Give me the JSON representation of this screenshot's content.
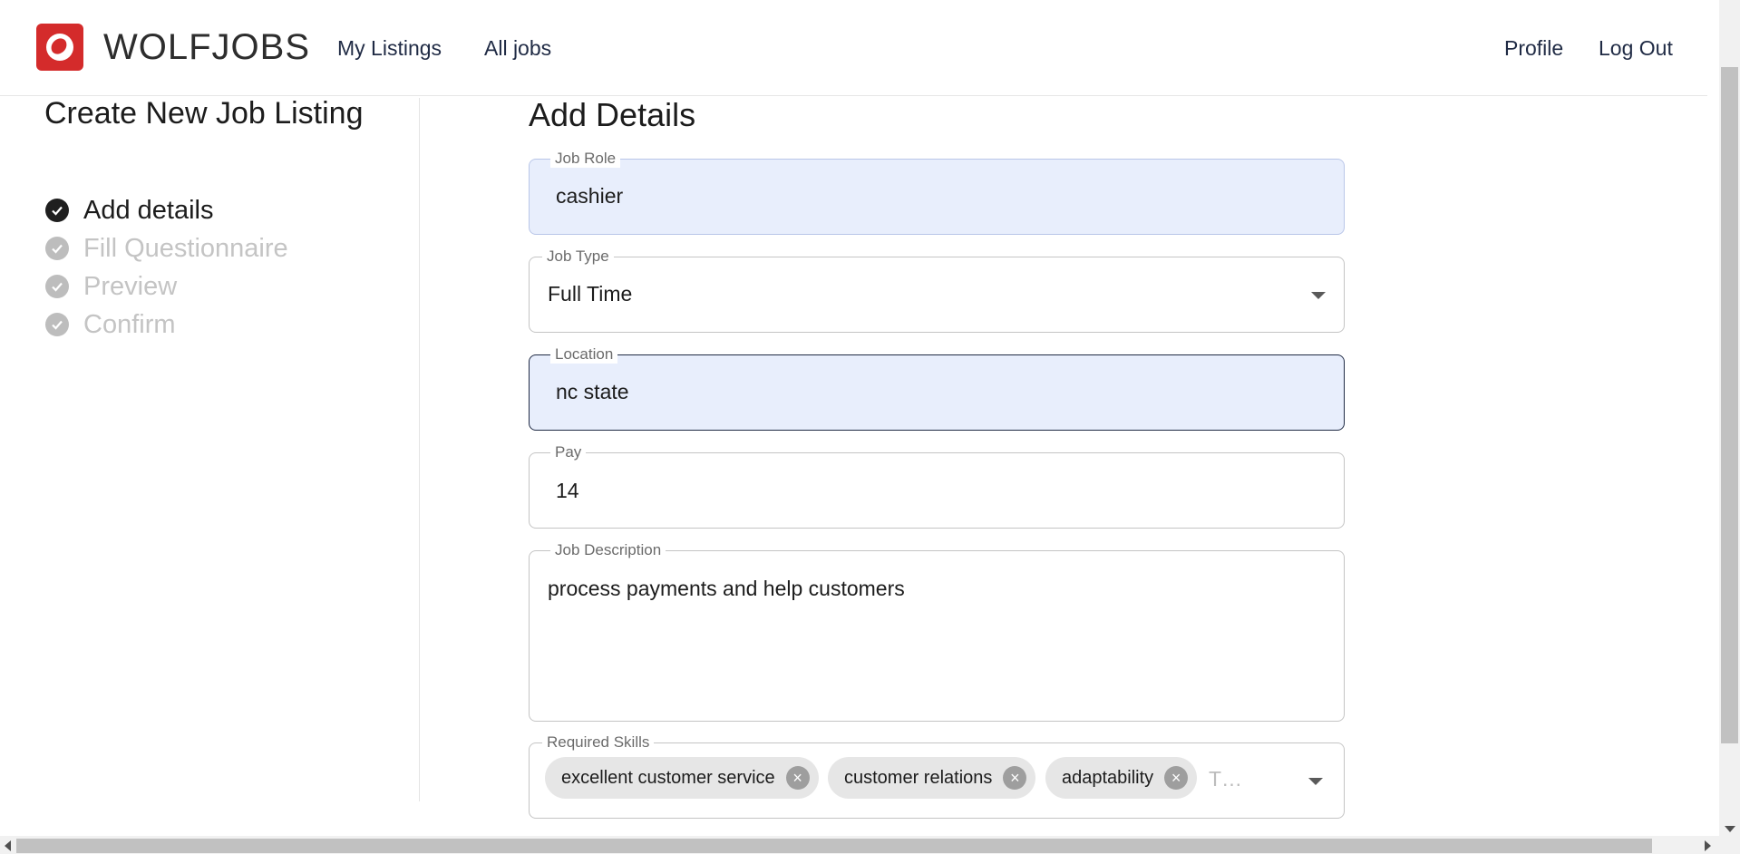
{
  "header": {
    "brand": "WOLFJOBS",
    "nav": {
      "my_listings": "My Listings",
      "all_jobs": "All jobs",
      "profile": "Profile",
      "logout": "Log Out"
    }
  },
  "sidebar": {
    "title": "Create New Job Listing",
    "steps": [
      {
        "label": "Add details",
        "status": "active"
      },
      {
        "label": "Fill Questionnaire",
        "status": "pending"
      },
      {
        "label": "Preview",
        "status": "pending"
      },
      {
        "label": "Confirm",
        "status": "pending"
      }
    ]
  },
  "form": {
    "title": "Add Details",
    "job_role": {
      "label": "Job Role",
      "value": "cashier"
    },
    "job_type": {
      "label": "Job Type",
      "value": "Full Time"
    },
    "location": {
      "label": "Location",
      "value": "nc state"
    },
    "pay": {
      "label": "Pay",
      "value": "14"
    },
    "job_description": {
      "label": "Job Description",
      "value": "process payments and help customers"
    },
    "required_skills": {
      "label": "Required Skills",
      "chips": [
        "excellent customer service",
        "customer relations",
        "adaptability"
      ],
      "input_placeholder": "T…"
    }
  },
  "colors": {
    "brand_red": "#d42b2b",
    "filled_field_bg": "#e8eefc",
    "nav_text": "#1f2a44"
  },
  "icons": {
    "logo": "wolf-logo-icon",
    "step_check": "check-circle-icon",
    "dropdown": "caret-down-icon",
    "chip_remove": "cancel-circle-icon"
  }
}
